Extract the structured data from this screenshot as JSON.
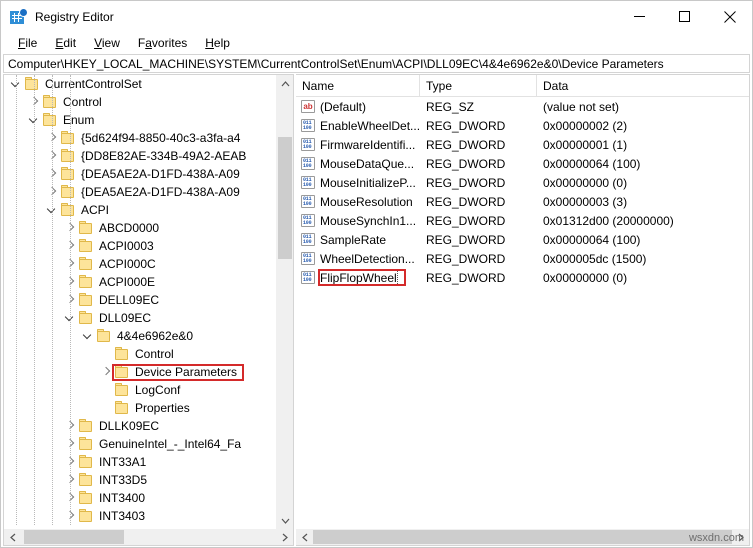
{
  "window": {
    "title": "Registry Editor",
    "icon": "registry-editor-icon",
    "controls": {
      "minimize": "minimize-icon",
      "maximize": "maximize-icon",
      "close": "close-icon"
    }
  },
  "menu": {
    "items": [
      {
        "label": "File",
        "accel": "F"
      },
      {
        "label": "Edit",
        "accel": "E"
      },
      {
        "label": "View",
        "accel": "V"
      },
      {
        "label": "Favorites",
        "accel": "a"
      },
      {
        "label": "Help",
        "accel": "H"
      }
    ]
  },
  "address": {
    "path": "Computer\\HKEY_LOCAL_MACHINE\\SYSTEM\\CurrentControlSet\\Enum\\ACPI\\DLL09EC\\4&4e6962e&0\\Device Parameters"
  },
  "tree": {
    "nodes": [
      {
        "label": "CurrentControlSet",
        "depth": 2,
        "state": "expanded"
      },
      {
        "label": "Control",
        "depth": 3,
        "state": "collapsed"
      },
      {
        "label": "Enum",
        "depth": 3,
        "state": "expanded"
      },
      {
        "label": "{5d624f94-8850-40c3-a3fa-a4",
        "depth": 4,
        "state": "collapsed"
      },
      {
        "label": "{DD8E82AE-334B-49A2-AEAB",
        "depth": 4,
        "state": "collapsed"
      },
      {
        "label": "{DEA5AE2A-D1FD-438A-A09",
        "depth": 4,
        "state": "collapsed"
      },
      {
        "label": "{DEA5AE2A-D1FD-438A-A09",
        "depth": 4,
        "state": "collapsed"
      },
      {
        "label": "ACPI",
        "depth": 4,
        "state": "expanded"
      },
      {
        "label": "ABCD0000",
        "depth": 5,
        "state": "collapsed"
      },
      {
        "label": "ACPI0003",
        "depth": 5,
        "state": "collapsed"
      },
      {
        "label": "ACPI000C",
        "depth": 5,
        "state": "collapsed"
      },
      {
        "label": "ACPI000E",
        "depth": 5,
        "state": "collapsed"
      },
      {
        "label": "DELL09EC",
        "depth": 5,
        "state": "collapsed"
      },
      {
        "label": "DLL09EC",
        "depth": 5,
        "state": "expanded"
      },
      {
        "label": "4&4e6962e&0",
        "depth": 6,
        "state": "expanded"
      },
      {
        "label": "Control",
        "depth": 7,
        "state": "leaf"
      },
      {
        "label": "Device Parameters",
        "depth": 7,
        "state": "collapsed",
        "highlight": true
      },
      {
        "label": "LogConf",
        "depth": 7,
        "state": "leaf"
      },
      {
        "label": "Properties",
        "depth": 7,
        "state": "leaf"
      },
      {
        "label": "DLLK09EC",
        "depth": 5,
        "state": "collapsed"
      },
      {
        "label": "GenuineIntel_-_Intel64_Fa",
        "depth": 5,
        "state": "collapsed"
      },
      {
        "label": "INT33A1",
        "depth": 5,
        "state": "collapsed"
      },
      {
        "label": "INT33D5",
        "depth": 5,
        "state": "collapsed"
      },
      {
        "label": "INT3400",
        "depth": 5,
        "state": "collapsed"
      },
      {
        "label": "INT3403",
        "depth": 5,
        "state": "collapsed"
      }
    ]
  },
  "list": {
    "columns": [
      "Name",
      "Type",
      "Data"
    ],
    "rows": [
      {
        "name": "(Default)",
        "type": "REG_SZ",
        "data": "(value not set)",
        "icon": "string-value-icon"
      },
      {
        "name": "EnableWheelDet...",
        "type": "REG_DWORD",
        "data": "0x00000002 (2)",
        "icon": "dword-value-icon"
      },
      {
        "name": "FirmwareIdentifi...",
        "type": "REG_DWORD",
        "data": "0x00000001 (1)",
        "icon": "dword-value-icon"
      },
      {
        "name": "MouseDataQue...",
        "type": "REG_DWORD",
        "data": "0x00000064 (100)",
        "icon": "dword-value-icon"
      },
      {
        "name": "MouseInitializeP...",
        "type": "REG_DWORD",
        "data": "0x00000000 (0)",
        "icon": "dword-value-icon"
      },
      {
        "name": "MouseResolution",
        "type": "REG_DWORD",
        "data": "0x00000003 (3)",
        "icon": "dword-value-icon"
      },
      {
        "name": "MouseSynchIn1...",
        "type": "REG_DWORD",
        "data": "0x01312d00 (20000000)",
        "icon": "dword-value-icon"
      },
      {
        "name": "SampleRate",
        "type": "REG_DWORD",
        "data": "0x00000064 (100)",
        "icon": "dword-value-icon"
      },
      {
        "name": "WheelDetection...",
        "type": "REG_DWORD",
        "data": "0x000005dc (1500)",
        "icon": "dword-value-icon"
      },
      {
        "name": "FlipFlopWheel",
        "type": "REG_DWORD",
        "data": "0x00000000 (0)",
        "icon": "dword-value-icon",
        "highlight": true,
        "focused": true
      }
    ]
  },
  "watermark": {
    "text": "wsxdn.com"
  },
  "colors": {
    "highlight_box": "#d42a2a",
    "folder_fill": "#fde49a",
    "folder_edge": "#e0b84a",
    "scrollbar_thumb": "#cdcdcd",
    "scrollbar_track": "#f0f0f0"
  }
}
